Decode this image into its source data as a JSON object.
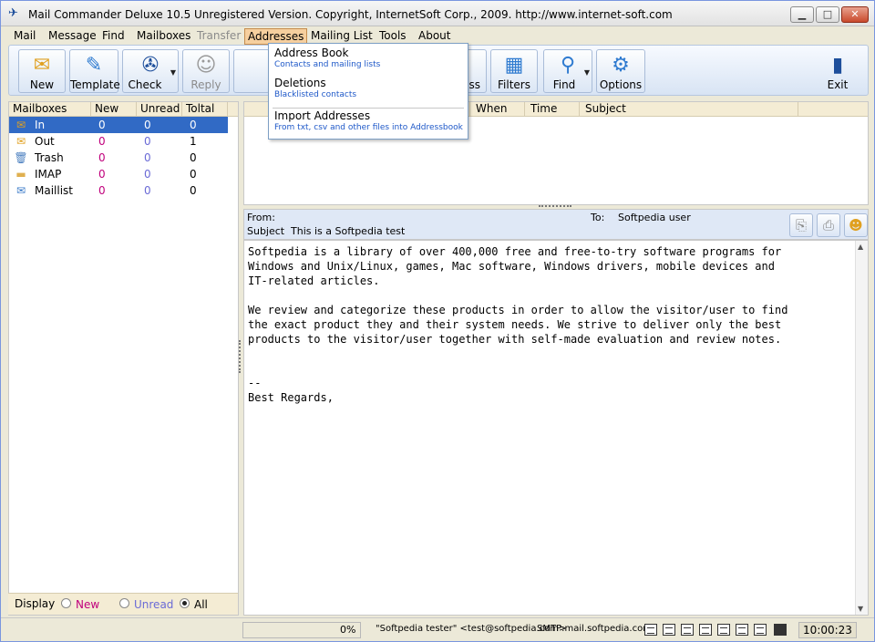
{
  "window": {
    "title": "Mail Commander Deluxe 10.5 Unregistered Version. Copyright, InternetSoft Corp., 2009. http://www.internet-soft.com",
    "controls": {
      "minimize": "▁",
      "maximize": "□",
      "close": "✕"
    }
  },
  "menu": [
    "Mail",
    "Message",
    "Find",
    "Mailboxes",
    "Transfer",
    "Addresses",
    "Mailing List",
    "Tools",
    "About"
  ],
  "active_menu": "Addresses",
  "toolbar": {
    "new": "New",
    "template": "Template",
    "check": "Check",
    "reply": "Reply",
    "hidden_partial": "ess",
    "filters": "Filters",
    "find": "Find",
    "options": "Options",
    "exit": "Exit"
  },
  "addresses_menu": [
    {
      "label": "Address Book",
      "desc": "Contacts and mailing lists"
    },
    {
      "label": "Deletions",
      "desc": "Blacklisted contacts"
    },
    {
      "label": "Import Addresses",
      "desc": "From txt, csv and other files into Addressbook"
    }
  ],
  "mailboxes": {
    "columns": [
      "Mailboxes",
      "New",
      "Unread",
      "Toltal"
    ],
    "rows": [
      {
        "name": "In",
        "new": "0",
        "unread": "0",
        "total": "0",
        "icon": "inbox-icon"
      },
      {
        "name": "Out",
        "new": "0",
        "unread": "0",
        "total": "1",
        "icon": "outbox-icon"
      },
      {
        "name": "Trash",
        "new": "0",
        "unread": "0",
        "total": "0",
        "icon": "trash-icon"
      },
      {
        "name": "IMAP",
        "new": "0",
        "unread": "0",
        "total": "0",
        "icon": "folder-icon"
      },
      {
        "name": "Maillist",
        "new": "0",
        "unread": "0",
        "total": "0",
        "icon": "maillist-icon"
      }
    ],
    "selected": "In"
  },
  "display_filter": {
    "label": "Display",
    "options": [
      "New",
      "Unread",
      "All"
    ],
    "selected": "All"
  },
  "message_list": {
    "columns": [
      "When",
      "Time",
      "Subject"
    ]
  },
  "message": {
    "from_label": "From:",
    "from": "",
    "to_label": "To:",
    "to": "Softpedia user",
    "subject_label": "Subject",
    "subject": "This is a Softpedia test",
    "body": "Softpedia is a library of over 400,000 free and free-to-try software programs for\nWindows and Unix/Linux, games, Mac software, Windows drivers, mobile devices and\nIT-related articles.\n\nWe review and categorize these products in order to allow the visitor/user to find\nthe exact product they and their system needs. We strive to deliver only the best\nproducts to the visitor/user together with self-made evaluation and review notes.\n\n\n--\nBest Regards,"
  },
  "status": {
    "progress": "0%",
    "account": "\"Softpedia tester\" <test@softpedia.com>",
    "smtp": "SMTP:mail.softpedia.com",
    "time": "10:00:23"
  },
  "colors": {
    "selection": "#316ac5",
    "new_count": "#c0007c",
    "unread_count": "#6a6ad6",
    "link_desc": "#1e58c8"
  }
}
